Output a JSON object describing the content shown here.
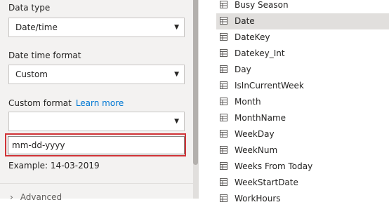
{
  "left": {
    "data_type_label": "Data type",
    "data_type_value": "Date/time",
    "datetime_format_label": "Date time format",
    "datetime_format_value": "Custom",
    "custom_format_label": "Custom format",
    "learn_more_label": "Learn more",
    "custom_format_select_value": "",
    "custom_format_input_value": "mm-dd-yyyy",
    "example_text": "Example: 14-03-2019",
    "advanced_label": "Advanced"
  },
  "fields": [
    {
      "name": "Busy Season",
      "selected": false,
      "icon": "table-icon"
    },
    {
      "name": "Date",
      "selected": true,
      "icon": "table-icon"
    },
    {
      "name": "DateKey",
      "selected": false,
      "icon": "table-icon"
    },
    {
      "name": "Datekey_Int",
      "selected": false,
      "icon": "table-icon"
    },
    {
      "name": "Day",
      "selected": false,
      "icon": "table-icon"
    },
    {
      "name": "IsInCurrentWeek",
      "selected": false,
      "icon": "table-icon"
    },
    {
      "name": "Month",
      "selected": false,
      "icon": "table-icon"
    },
    {
      "name": "MonthName",
      "selected": false,
      "icon": "table-icon"
    },
    {
      "name": "WeekDay",
      "selected": false,
      "icon": "table-icon"
    },
    {
      "name": "WeekNum",
      "selected": false,
      "icon": "table-icon"
    },
    {
      "name": "Weeks From Today",
      "selected": false,
      "icon": "table-icon"
    },
    {
      "name": "WeekStartDate",
      "selected": false,
      "icon": "table-icon"
    },
    {
      "name": "WorkHours",
      "selected": false,
      "icon": "table-icon"
    }
  ],
  "colors": {
    "highlight": "#d13438",
    "link": "#0078d4",
    "selected_row": "#e1dfdd"
  }
}
